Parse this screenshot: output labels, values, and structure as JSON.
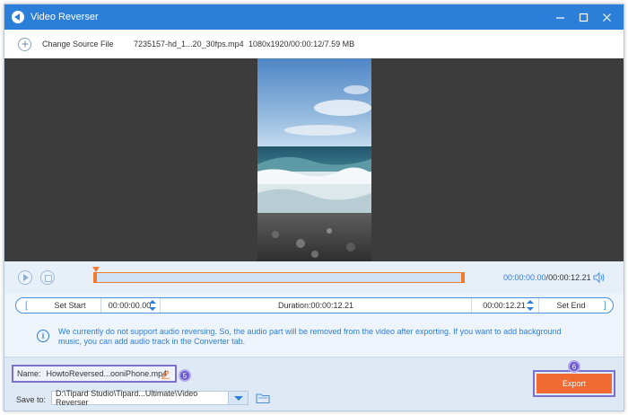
{
  "window": {
    "title": "Video Reverser",
    "controls": [
      "minimize-icon",
      "maximize-icon",
      "close-icon"
    ]
  },
  "source": {
    "add_label": "Change Source File",
    "file_name": "7235157-hd_1...20_30fps.mp4",
    "file_meta": "1080x1920/00:00:12/7.59 MB"
  },
  "timeline": {
    "current_time": "00:00:00.00",
    "separator": "/",
    "total_time": "00:00:12.21"
  },
  "clip": {
    "bracket_left": "[",
    "set_start_label": "Set Start",
    "start_time": "00:00:00.00",
    "duration": "Duration:00:00:12.21",
    "end_time": "00:00:12.21",
    "set_end_label": "Set End",
    "bracket_right": "]"
  },
  "notice": {
    "icon": "i",
    "text": "We currently do not support audio reversing. So, the audio part will be removed from the video after exporting. If you want to add background music, you can add audio track in the Converter tab."
  },
  "output": {
    "name_label": "Name:",
    "name_value": "HowtoReversed...ooniPhone.mp4",
    "save_label": "Save to:",
    "save_path": "D:\\Tipard Studio\\Tipard...Ultimate\\Video Reverser",
    "export_label": "Export"
  },
  "steps": {
    "step_5": "5",
    "step_6": "6"
  },
  "colors": {
    "accent": "#2c7fd8",
    "export": "#f06a32",
    "highlight": "#7d6fd0",
    "track": "#f07b2f"
  }
}
